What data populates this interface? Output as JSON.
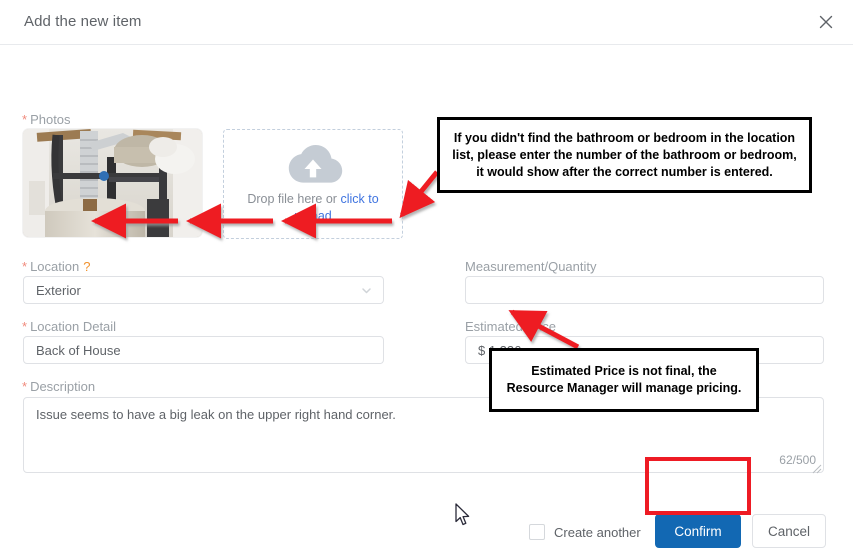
{
  "dialog": {
    "title": "Add the new item",
    "close_icon": "close-icon"
  },
  "form": {
    "photos": {
      "label": "Photos",
      "required_marker": "*",
      "thumbnail_alt": "plumbing water heater photo",
      "dropzone": {
        "icon": "cloud-upload-icon",
        "text_primary": "Drop file here or ",
        "text_link": "click to upload"
      }
    },
    "location": {
      "label": "Location",
      "required_marker": "*",
      "help_marker": "?",
      "value": "Exterior",
      "chevron_icon": "chevron-down-icon"
    },
    "measurement": {
      "label": "Measurement/Quantity",
      "value": "",
      "placeholder": ""
    },
    "location_detail": {
      "label": "Location Detail",
      "required_marker": "*",
      "value": "Back of House"
    },
    "estimated_price": {
      "label": "Estimated Price",
      "value": "$ 1,236"
    },
    "description": {
      "label": "Description",
      "required_marker": "*",
      "value": "Issue seems to have a big leak on the upper right hand corner.",
      "counter": "62/500"
    }
  },
  "footer": {
    "create_another_label": "Create another",
    "confirm_label": "Confirm",
    "cancel_label": "Cancel"
  },
  "annotations": {
    "location_note": "If you didn't find the bathroom or bedroom in the location list, please enter the number of  the bathroom or bedroom, it would show after the correct number is entered.",
    "price_note": "Estimated Price is not final, the Resource Manager will manage pricing."
  },
  "colors": {
    "accent_blue": "#1268b3",
    "annotation_red": "#ee1b24",
    "required_red": "#f08a7c",
    "help_orange": "#f0922f",
    "link_blue": "#3f74e0",
    "border_gray": "#dfe1e5",
    "label_gray": "#9aa0a6"
  }
}
